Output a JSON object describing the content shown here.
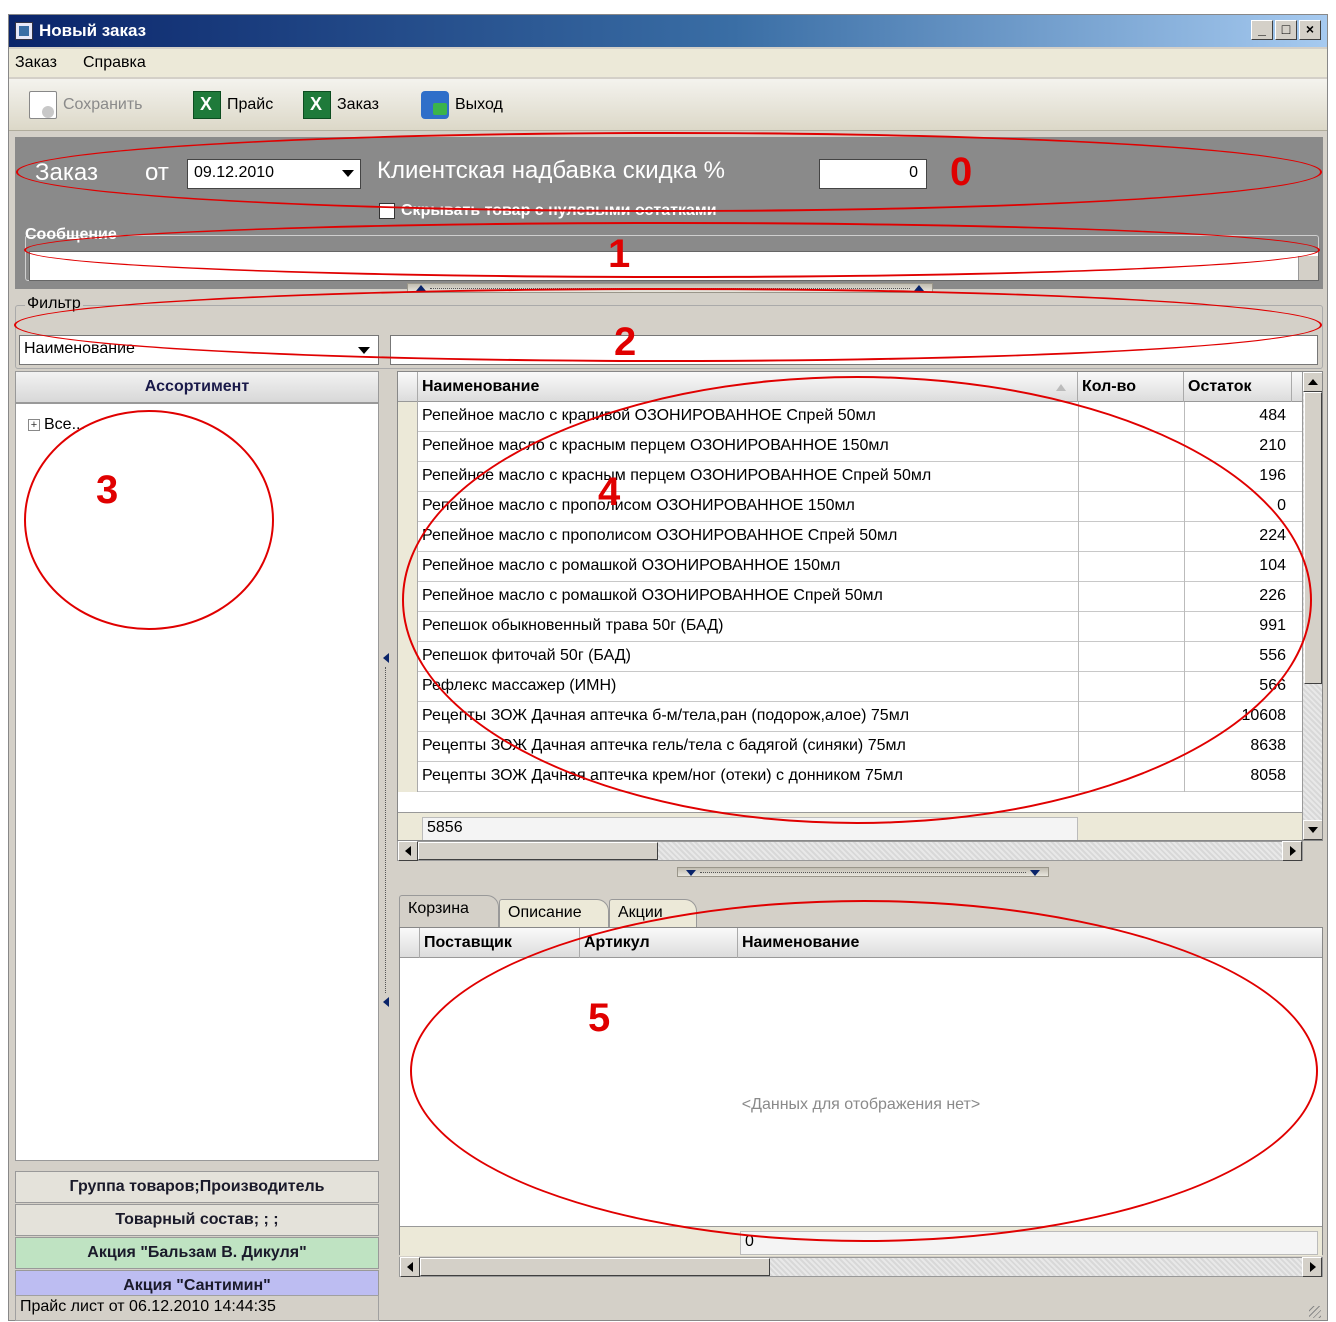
{
  "window": {
    "title": "Новый заказ"
  },
  "menu": {
    "items": [
      "Заказ",
      "Справка"
    ]
  },
  "toolbar": {
    "save": "Сохранить",
    "price": "Прайс",
    "order": "Заказ",
    "exit": "Выход"
  },
  "header": {
    "order_label": "Заказ",
    "from_label": "от",
    "date_value": "09.12.2010",
    "markup_label": "Клиентская надбавка скидка %",
    "markup_value": "0",
    "hide_zero_label": "Скрывать товар с нулевыми остатками",
    "message_legend": "Сообщение",
    "message_value": ""
  },
  "filter": {
    "legend": "Фильтр",
    "field": "Наименование",
    "value": ""
  },
  "assortment": {
    "header": "Ассортимент",
    "tree_root": "Все...",
    "buttons": [
      {
        "label": "Группа товаров;Производитель",
        "color": "#e4e2da"
      },
      {
        "label": "Товарный состав; ; ;",
        "color": "#e4e2da"
      },
      {
        "label": "Акция \"Бальзам В. Дикуля\"",
        "color": "#bfe3c2"
      },
      {
        "label": "Акция \"Сантимин\"",
        "color": "#bdbdf2"
      }
    ]
  },
  "products": {
    "columns": {
      "name": "Наименование",
      "qty": "Кол-во",
      "rest": "Остаток"
    },
    "rows": [
      {
        "name": "Репейное масло с крапивой ОЗОНИРОВАННОЕ Спрей 50мл",
        "qty": "",
        "rest": "484"
      },
      {
        "name": "Репейное масло с красным перцем ОЗОНИРОВАННОЕ 150мл",
        "qty": "",
        "rest": "210"
      },
      {
        "name": "Репейное масло с красным перцем ОЗОНИРОВАННОЕ Спрей 50мл",
        "qty": "",
        "rest": "196"
      },
      {
        "name": "Репейное масло с прополисом ОЗОНИРОВАННОЕ 150мл",
        "qty": "",
        "rest": "0"
      },
      {
        "name": "Репейное масло с прополисом ОЗОНИРОВАННОЕ Спрей 50мл",
        "qty": "",
        "rest": "224"
      },
      {
        "name": "Репейное масло с ромашкой ОЗОНИРОВАННОЕ 150мл",
        "qty": "",
        "rest": "104"
      },
      {
        "name": "Репейное масло с ромашкой ОЗОНИРОВАННОЕ Спрей 50мл",
        "qty": "",
        "rest": "226"
      },
      {
        "name": "Репешок обыкновенный трава 50г (БАД)",
        "qty": "",
        "rest": "991"
      },
      {
        "name": "Репешок фиточай 50г (БАД)",
        "qty": "",
        "rest": "556"
      },
      {
        "name": "Рефлекс массажер  (ИМН)",
        "qty": "",
        "rest": "566"
      },
      {
        "name": "Рецепты ЗОЖ Дачная аптечка б-м/тела,ран (подорож,алое) 75мл",
        "qty": "",
        "rest": "10608"
      },
      {
        "name": "Рецепты ЗОЖ Дачная аптечка гель/тела с бадягой (синяки) 75мл",
        "qty": "",
        "rest": "8638"
      },
      {
        "name": "Рецепты ЗОЖ Дачная аптечка крем/ног (отеки) с донником 75мл",
        "qty": "",
        "rest": "8058"
      }
    ],
    "footer_count": "5856"
  },
  "tabs": [
    "Корзина",
    "Описание",
    "Акции"
  ],
  "basket": {
    "columns": {
      "supplier": "Поставщик",
      "article": "Артикул",
      "name": "Наименование"
    },
    "empty": "<Данных для отображения нет>",
    "footer_count": "0"
  },
  "status": {
    "price_list": "Прайс лист от 06.12.2010 14:44:35"
  },
  "annotations": [
    "0",
    "1",
    "2",
    "3",
    "4",
    "5"
  ]
}
